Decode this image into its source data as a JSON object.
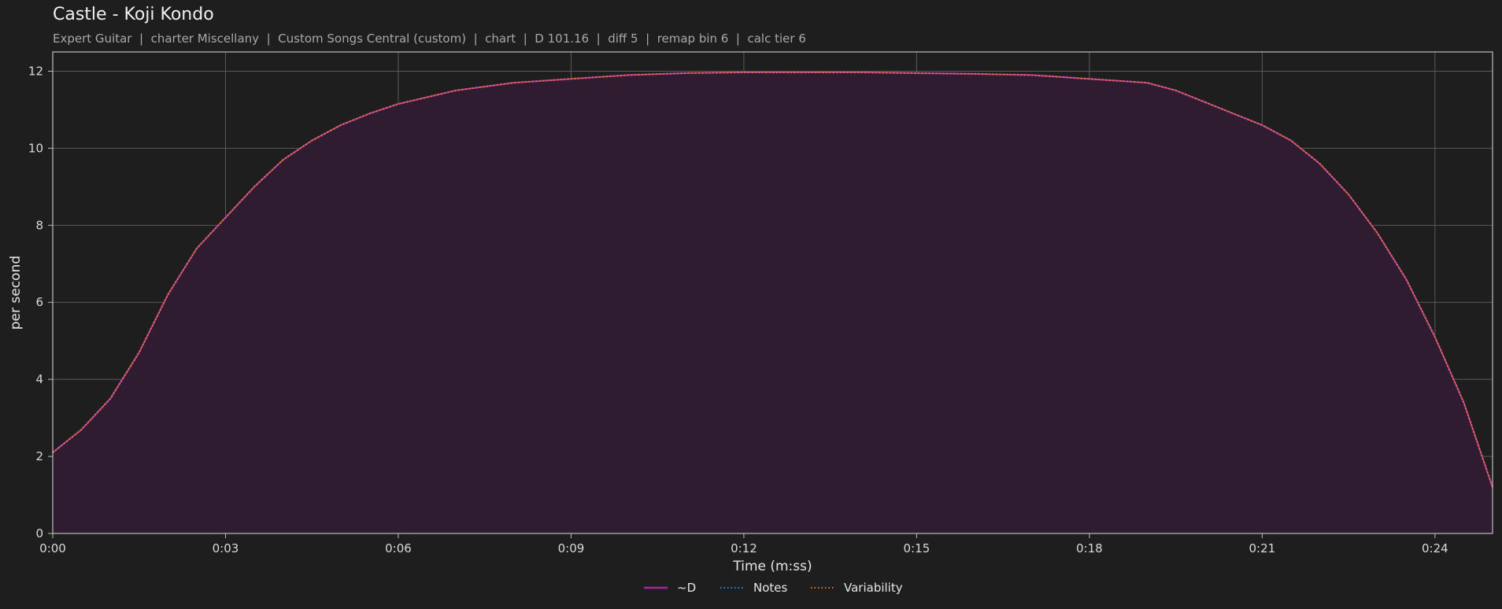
{
  "header": {
    "title": "Castle - Koji Kondo",
    "subtitle": "Expert Guitar  |  charter Miscellany  |  Custom Songs Central (custom)  |  chart  |  D 101.16  |  diff 5  |  remap bin 6  |  calc tier 6"
  },
  "colors": {
    "background": "#1e1e1e",
    "grid": "#5a5a5a",
    "axis": "#bdbdbd",
    "d_line": "#b0209d",
    "d_fill": "#2f1c30",
    "notes": "#1f8fd6",
    "variability": "#e0762c"
  },
  "chart_data": {
    "type": "line",
    "title": "Castle - Koji Kondo",
    "xlabel": "Time (m:ss)",
    "ylabel": "per second",
    "xlim": [
      0,
      25
    ],
    "ylim": [
      0,
      12.5
    ],
    "grid": true,
    "legend_position": "bottom-center",
    "x_ticks": [
      0,
      3,
      6,
      9,
      12,
      15,
      18,
      21,
      24
    ],
    "x_tick_labels": [
      "0:00",
      "0:03",
      "0:06",
      "0:09",
      "0:12",
      "0:15",
      "0:18",
      "0:21",
      "0:24"
    ],
    "y_ticks": [
      0,
      2,
      4,
      6,
      8,
      10,
      12
    ],
    "y_tick_labels": [
      "0",
      "2",
      "4",
      "6",
      "8",
      "10",
      "12"
    ],
    "x": [
      0,
      0.5,
      1,
      1.5,
      2,
      2.5,
      3,
      3.5,
      4,
      4.5,
      5,
      5.5,
      6,
      7,
      8,
      9,
      10,
      11,
      12,
      13,
      14,
      15,
      16,
      17,
      18,
      19,
      19.5,
      20,
      20.5,
      21,
      21.5,
      22,
      22.5,
      23,
      23.5,
      24,
      24.5,
      25
    ],
    "series": [
      {
        "name": "~D",
        "style": "solid",
        "filled": true,
        "values": [
          2.1,
          2.7,
          3.5,
          4.7,
          6.2,
          7.4,
          8.2,
          9.0,
          9.7,
          10.2,
          10.6,
          10.9,
          11.15,
          11.5,
          11.7,
          11.8,
          11.9,
          11.95,
          11.97,
          11.97,
          11.97,
          11.95,
          11.93,
          11.9,
          11.8,
          11.7,
          11.5,
          11.2,
          10.9,
          10.6,
          10.2,
          9.6,
          8.8,
          7.8,
          6.6,
          5.1,
          3.4,
          1.2
        ]
      },
      {
        "name": "Notes",
        "style": "dotted",
        "filled": false,
        "values": [
          2.1,
          2.7,
          3.5,
          4.7,
          6.2,
          7.4,
          8.2,
          9.0,
          9.7,
          10.2,
          10.6,
          10.9,
          11.15,
          11.5,
          11.7,
          11.8,
          11.9,
          11.95,
          11.97,
          11.97,
          11.97,
          11.95,
          11.93,
          11.9,
          11.8,
          11.7,
          11.5,
          11.2,
          10.9,
          10.6,
          10.2,
          9.6,
          8.8,
          7.8,
          6.6,
          5.1,
          3.4,
          1.2
        ]
      },
      {
        "name": "Variability",
        "style": "dotted",
        "filled": false,
        "values": [
          2.1,
          2.7,
          3.5,
          4.7,
          6.2,
          7.4,
          8.2,
          9.0,
          9.7,
          10.2,
          10.6,
          10.9,
          11.15,
          11.5,
          11.7,
          11.8,
          11.9,
          11.95,
          11.97,
          11.97,
          11.97,
          11.95,
          11.93,
          11.9,
          11.8,
          11.7,
          11.5,
          11.2,
          10.9,
          10.6,
          10.2,
          9.6,
          8.8,
          7.8,
          6.6,
          5.1,
          3.4,
          1.2
        ]
      }
    ]
  }
}
